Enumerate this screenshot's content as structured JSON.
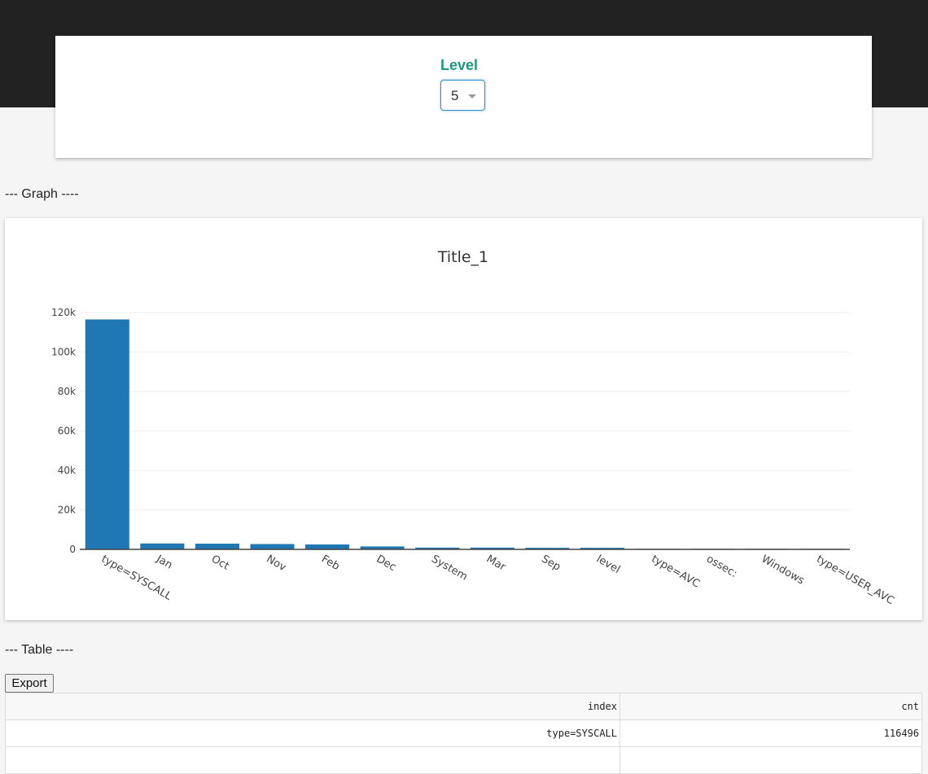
{
  "level_panel": {
    "label": "Level",
    "selected": "5"
  },
  "graph_section_label": "--- Graph ----",
  "table_section_label": "--- Table ----",
  "colors": {
    "accent": "#1a9b7f",
    "bar": "#1f77b4",
    "header_bg": "#222222"
  },
  "chart_data": {
    "type": "bar",
    "title": "Title_1",
    "xlabel": "",
    "ylabel": "",
    "categories": [
      "type=SYSCALL",
      "Jan",
      "Oct",
      "Nov",
      "Feb",
      "Dec",
      "System",
      "Mar",
      "Sep",
      "level",
      "type=AVC",
      "ossec:",
      "Windows",
      "type=USER_AVC"
    ],
    "values": [
      116496,
      3000,
      2900,
      2700,
      2500,
      1500,
      900,
      900,
      800,
      800,
      300,
      300,
      300,
      300
    ],
    "ylim": [
      0,
      120000
    ],
    "yticks": [
      0,
      20000,
      40000,
      60000,
      80000,
      100000,
      120000
    ],
    "ytick_labels": [
      "0",
      "20k",
      "40k",
      "60k",
      "80k",
      "100k",
      "120k"
    ],
    "grid": true,
    "legend": "none"
  },
  "table": {
    "export_label": "Export",
    "columns": [
      "index",
      "cnt"
    ],
    "rows": [
      [
        "type=SYSCALL",
        "116496"
      ],
      [
        "",
        ""
      ]
    ]
  }
}
